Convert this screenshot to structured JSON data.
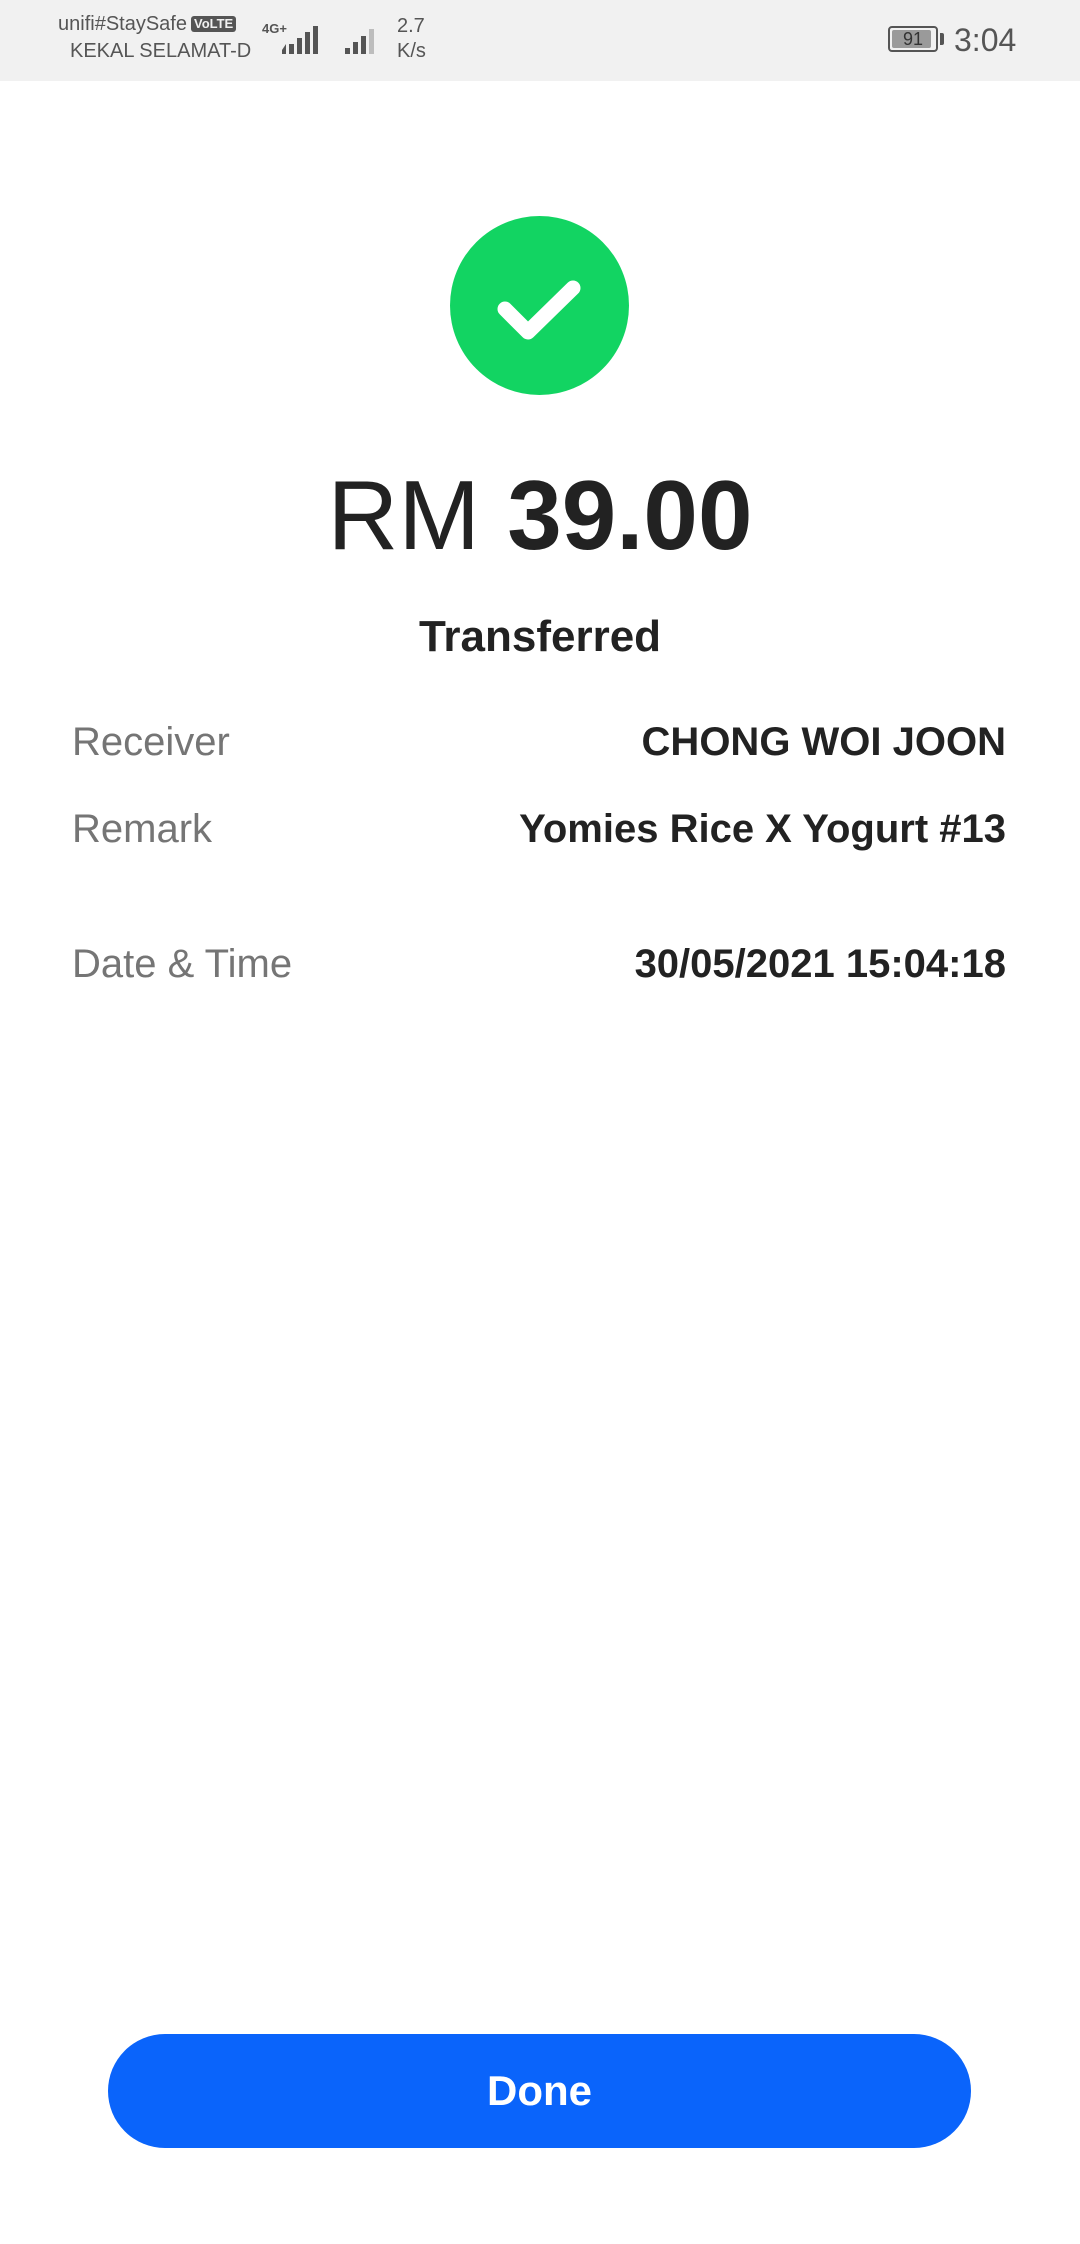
{
  "status_bar": {
    "carrier_name": "unifi#StaySafe",
    "volte_label": "VoLTE",
    "carrier_subtitle": "KEKAL SELAMAT-D",
    "network_type": "4G+",
    "net_speed_value": "2.7",
    "net_speed_unit": "K/s",
    "battery_percent": "91",
    "time": "3:04"
  },
  "transaction": {
    "currency": "RM",
    "amount": "39.00",
    "status": "Transferred",
    "details": [
      {
        "label": "Receiver",
        "value": "CHONG WOI JOON"
      },
      {
        "label": "Remark",
        "value": "Yomies Rice X Yogurt #13"
      },
      {
        "label": "Date & Time",
        "value": "30/05/2021 15:04:18"
      }
    ]
  },
  "actions": {
    "done_label": "Done"
  },
  "colors": {
    "success_green": "#12d462",
    "primary_blue": "#0a64fb",
    "status_bar_bg": "#f1f1f1"
  },
  "icons": {
    "success": "check-icon"
  }
}
